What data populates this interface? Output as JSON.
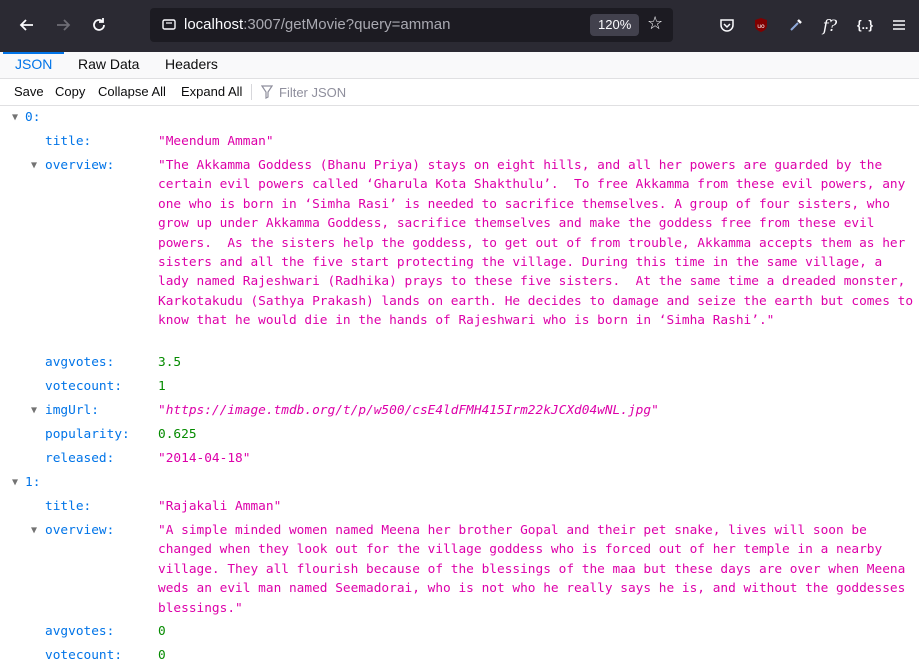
{
  "browser": {
    "url_host": "localhost",
    "url_rest": ":3007/getMovie?query=amman",
    "zoom": "120%",
    "extension_icons": [
      "ublock-icon",
      "eyedropper-icon",
      "fx-icon",
      "json-icon"
    ]
  },
  "viewer": {
    "tabs": [
      "JSON",
      "Raw Data",
      "Headers"
    ],
    "actions": [
      "Save",
      "Copy",
      "Collapse All",
      "Expand All"
    ],
    "filter_placeholder": "Filter JSON"
  },
  "items": [
    {
      "index": "0:",
      "title_key": "title:",
      "title": "\"Meendum Amman\"",
      "overview_key": "overview:",
      "overview": "\"The Akkamma Goddess (Bhanu Priya) stays on eight hills, and all her powers are guarded by the certain evil powers called ‘Gharula Kota Shakthulu’.  To free Akkamma from these evil powers, any one who is born in ‘Simha Rasi’ is needed to sacrifice themselves. A group of four sisters, who grow up under Akkamma Goddess, sacrifice themselves and make the goddess free from these evil powers.  As the sisters help the goddess, to get out of from trouble, Akkamma accepts them as her sisters and all the five start protecting the village. During this time in the same village, a lady named Rajeshwari (Radhika) prays to these five sisters.  At the same time a dreaded monster, Karkotakudu (Sathya Prakash) lands on earth. He decides to damage and seize the earth but comes to know that he would die in the hands of Rajeshwari who is born in ‘Simha Rashi’.\"",
      "avgvotes_key": "avgvotes:",
      "avgvotes": "3.5",
      "votecount_key": "votecount:",
      "votecount": "1",
      "imgUrl_key": "imgUrl:",
      "imgUrl": "\"https://image.tmdb.org/t/p/w500/csE4ldFMH415Irm22kJCXd04wNL.jpg\"",
      "popularity_key": "popularity:",
      "popularity": "0.625",
      "released_key": "released:",
      "released": "\"2014-04-18\""
    },
    {
      "index": "1:",
      "title_key": "title:",
      "title": "\"Rajakali Amman\"",
      "overview_key": "overview:",
      "overview": "\"A simple minded women named Meena her brother Gopal and their pet snake, lives will soon be changed when they look out for the village goddess who is forced out of her temple in a nearby village. They all flourish because of the blessings of the maa but these days are over when Meena weds an evil man named Seemadorai, who is not who he really says he is, and without the goddesses blessings.\"",
      "avgvotes_key": "avgvotes:",
      "avgvotes": "0",
      "votecount_key": "votecount:",
      "votecount": "0"
    }
  ]
}
